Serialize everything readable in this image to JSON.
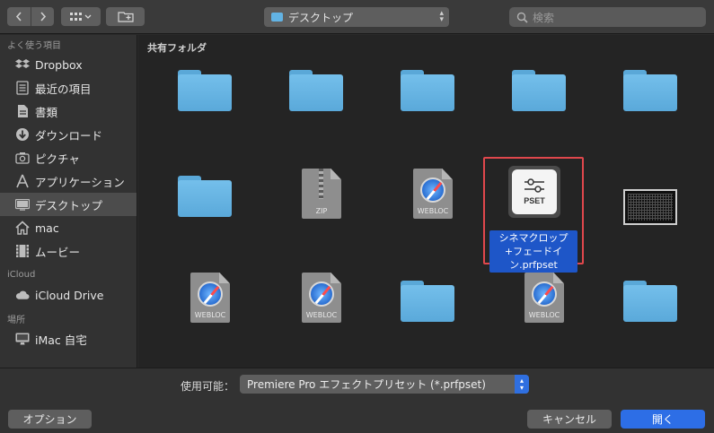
{
  "toolbar": {
    "back_icon": "chevron-left",
    "forward_icon": "chevron-right",
    "view_icon": "grid-view",
    "new_folder_icon": "new-folder",
    "location": "デスクトップ",
    "search_placeholder": "検索"
  },
  "sidebar": {
    "favorites_heading": "よく使う項目",
    "favorites": [
      {
        "label": "Dropbox",
        "icon": "dropbox-icon"
      },
      {
        "label": "最近の項目",
        "icon": "recent-icon"
      },
      {
        "label": "書類",
        "icon": "documents-icon"
      },
      {
        "label": "ダウンロード",
        "icon": "download-icon"
      },
      {
        "label": "ピクチャ",
        "icon": "camera-icon"
      },
      {
        "label": "アプリケーション",
        "icon": "applications-icon"
      },
      {
        "label": "デスクトップ",
        "icon": "desktop-icon",
        "active": true
      },
      {
        "label": "mac",
        "icon": "home-icon"
      },
      {
        "label": "ムービー",
        "icon": "movie-icon"
      }
    ],
    "icloud_heading": "iCloud",
    "icloud": [
      {
        "label": "iCloud Drive",
        "icon": "cloud-icon"
      }
    ],
    "places_heading": "場所",
    "places": [
      {
        "label": "iMac 自宅",
        "icon": "imac-icon"
      }
    ]
  },
  "main": {
    "section_title": "共有フォルダ",
    "items": [
      {
        "type": "folder"
      },
      {
        "type": "folder"
      },
      {
        "type": "folder"
      },
      {
        "type": "folder"
      },
      {
        "type": "folder"
      },
      {
        "type": "folder"
      },
      {
        "type": "zip",
        "badge": "ZIP"
      },
      {
        "type": "webloc",
        "badge": "WEBLOC"
      },
      {
        "type": "pset",
        "badge": "PSET",
        "name": "シネマクロップ+フェードイン.prfpset",
        "selected": true
      },
      {
        "type": "thumbnail"
      },
      {
        "type": "webloc",
        "badge": "WEBLOC"
      },
      {
        "type": "webloc",
        "badge": "WEBLOC"
      },
      {
        "type": "folder"
      },
      {
        "type": "webloc",
        "badge": "WEBLOC"
      },
      {
        "type": "folder"
      }
    ],
    "selection_color": "#1e56c8",
    "highlight_color": "#e0474c"
  },
  "filter": {
    "label": "使用可能：",
    "value": "Premiere Pro エフェクトプリセット (*.prfpset)"
  },
  "buttons": {
    "options": "オプション",
    "cancel": "キャンセル",
    "open": "開く"
  }
}
